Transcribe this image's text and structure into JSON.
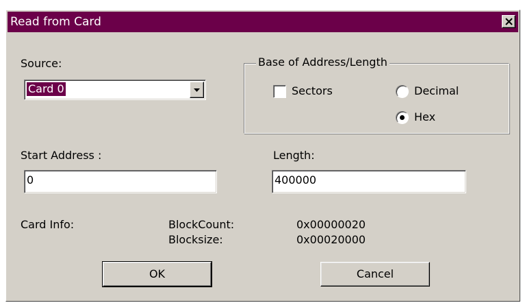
{
  "window": {
    "title": "Read from Card"
  },
  "source": {
    "label": "Source:",
    "selected": "Card 0"
  },
  "base": {
    "legend": "Base of Address/Length",
    "sectors_label": "Sectors",
    "sectors_checked": false,
    "decimal_label": "Decimal",
    "hex_label": "Hex",
    "selected": "Hex"
  },
  "start_address": {
    "label": "Start Address :",
    "value": "0"
  },
  "length": {
    "label": "Length:",
    "value": "400000"
  },
  "card_info": {
    "label": "Card Info:",
    "blockcount_label": "BlockCount:",
    "blockcount_value": "0x00000020",
    "blocksize_label": "Blocksize:",
    "blocksize_value": "0x00020000"
  },
  "buttons": {
    "ok": "OK",
    "cancel": "Cancel"
  },
  "colors": {
    "titlebar": "#6b0049",
    "face": "#d4d0c8"
  }
}
